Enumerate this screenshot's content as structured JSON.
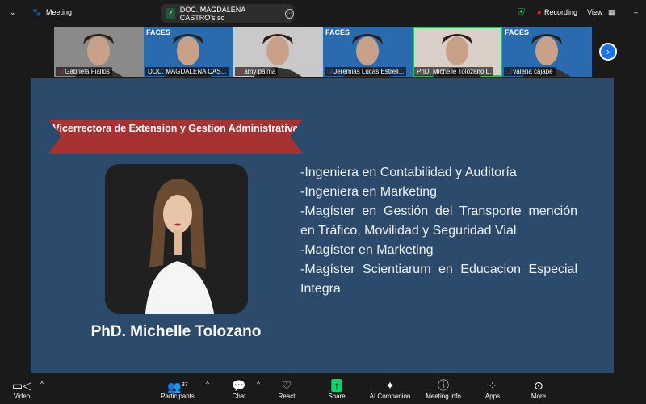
{
  "topbar": {
    "meeting_label": "Meeting",
    "share_title": "DOC. MAGDALENA CASTRO's sc",
    "share_initial": "Z",
    "recording": "Recording",
    "view": "View"
  },
  "participants": [
    {
      "name": "Gabriela Fiallos",
      "bg": "#8a8a8a",
      "faces": false,
      "muted": true
    },
    {
      "name": "DOC. MAGDALENA CAS...",
      "bg": "#2a6bb0",
      "faces": true,
      "muted": false
    },
    {
      "name": "amy palma",
      "bg": "#c9c9c9",
      "faces": false,
      "muted": true
    },
    {
      "name": "Jeremias Lucas Estrell...",
      "bg": "#2a6bb0",
      "faces": true,
      "muted": true
    },
    {
      "name": "PhD. Michelle Tolozano L.",
      "bg": "#d9cfc8",
      "faces": false,
      "muted": false,
      "active": true
    },
    {
      "name": "valeria cajape",
      "bg": "#2a6bb0",
      "faces": true,
      "muted": true
    }
  ],
  "faces_label": "FACES",
  "slide": {
    "banner": "Vicerrectora de Extension y Gestion Administrativa",
    "name": "PhD. Michelle Tolozano",
    "credentials": [
      "-Ingeniera en Contabilidad y Auditoría",
      "-Ingeniera en Marketing",
      "-Magíster en Gestión del Transporte mención en Tráfico, Movilidad y Seguridad Vial",
      "-Magíster en Marketing",
      "-Magíster Scientiarum en Educacion Especial Integra"
    ]
  },
  "toolbar": {
    "video": "Video",
    "participants": "Participants",
    "participants_count": "37",
    "chat": "Chat",
    "react": "React",
    "share": "Share",
    "ai": "AI Companion",
    "info": "Meeting info",
    "apps": "Apps",
    "more": "More"
  },
  "colors": {
    "slide": "#2c4a6b",
    "ribbon": "#a83232",
    "share": "#0bd36b",
    "active": "#22c55e"
  }
}
